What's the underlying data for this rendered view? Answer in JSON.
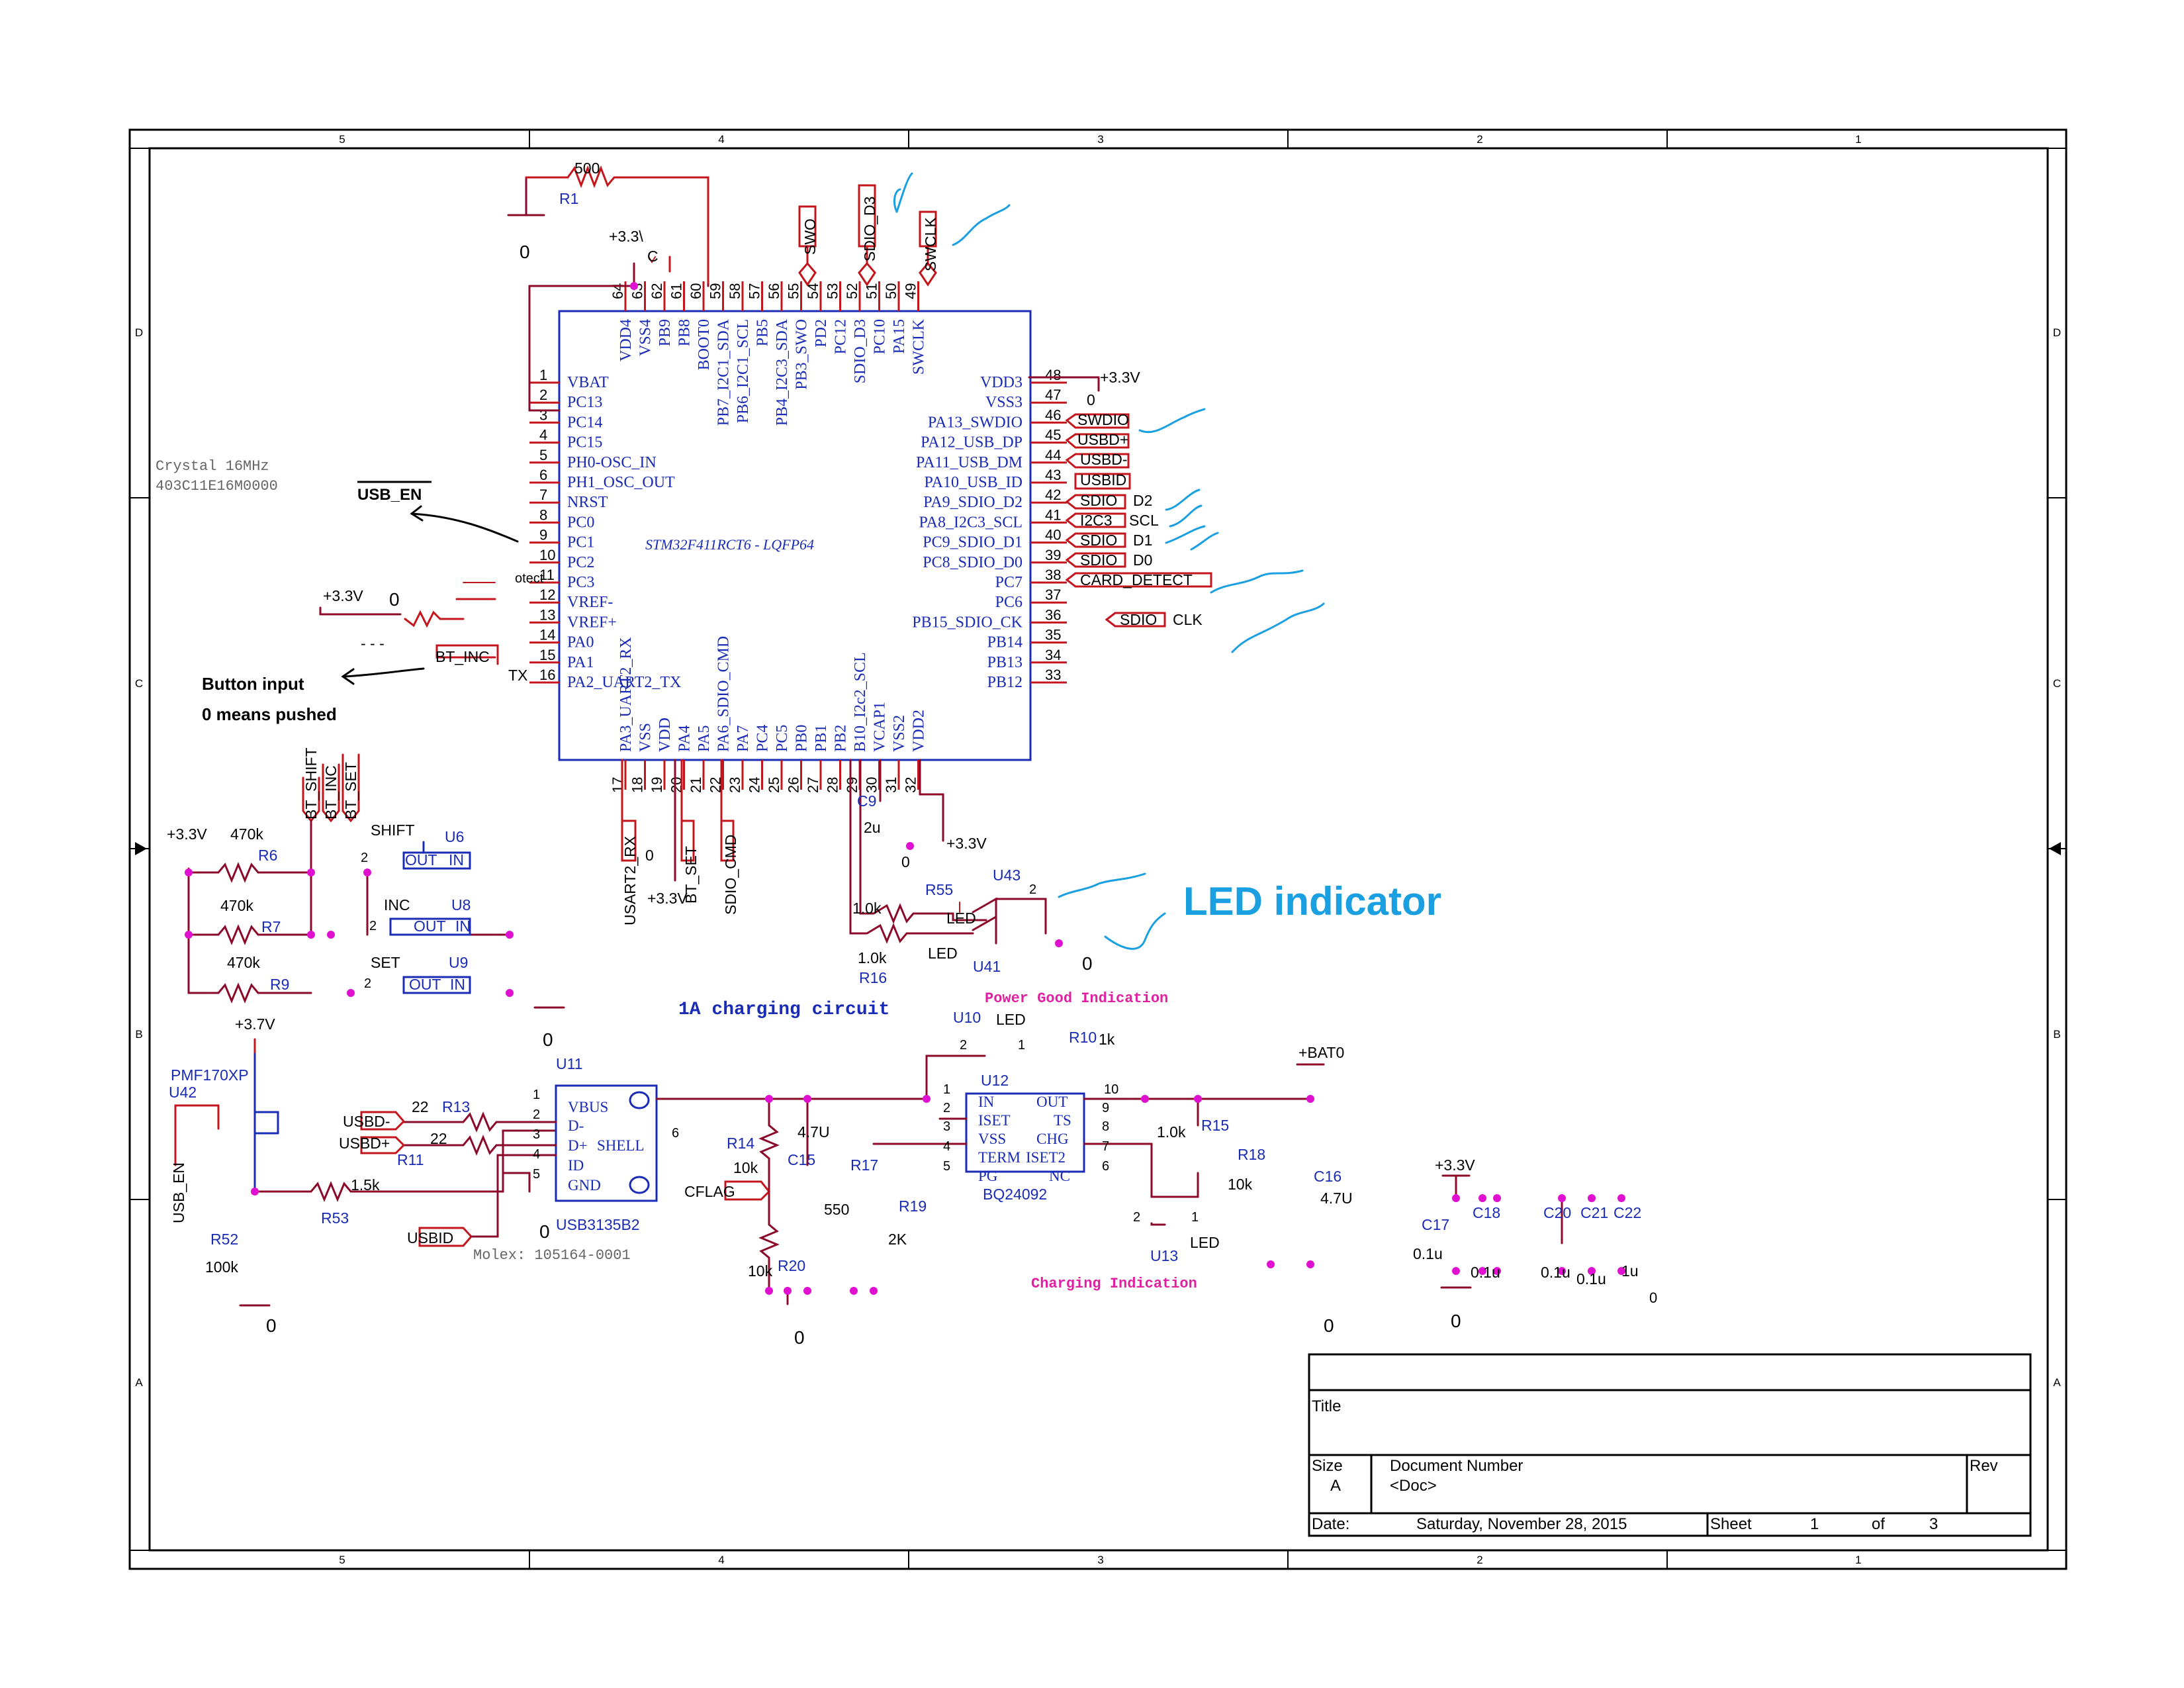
{
  "border": {
    "cols": [
      "5",
      "4",
      "3",
      "2",
      "1"
    ],
    "rows": [
      "D",
      "C",
      "B",
      "A"
    ]
  },
  "mcu": {
    "part": "STM32F411RCT6 - LQFP64",
    "left_pins": [
      {
        "num": "1",
        "name": "VBAT"
      },
      {
        "num": "2",
        "name": "PC13"
      },
      {
        "num": "3",
        "name": "PC14"
      },
      {
        "num": "4",
        "name": "PC15"
      },
      {
        "num": "5",
        "name": "PH0-OSC_IN"
      },
      {
        "num": "6",
        "name": "PH1_OSC_OUT"
      },
      {
        "num": "7",
        "name": "NRST"
      },
      {
        "num": "8",
        "name": "PC0"
      },
      {
        "num": "9",
        "name": "PC1"
      },
      {
        "num": "10",
        "name": "PC2"
      },
      {
        "num": "11",
        "name": "PC3"
      },
      {
        "num": "12",
        "name": "VREF-"
      },
      {
        "num": "13",
        "name": "VREF+"
      },
      {
        "num": "14",
        "name": "PA0"
      },
      {
        "num": "15",
        "name": "PA1"
      },
      {
        "num": "16",
        "name": "PA2_UART2_TX"
      }
    ],
    "right_pins": [
      {
        "num": "48",
        "name": "VDD3"
      },
      {
        "num": "47",
        "name": "VSS3"
      },
      {
        "num": "46",
        "name": "PA13_SWDIO"
      },
      {
        "num": "45",
        "name": "PA12_USB_DP"
      },
      {
        "num": "44",
        "name": "PA11_USB_DM"
      },
      {
        "num": "43",
        "name": "PA10_USB_ID"
      },
      {
        "num": "42",
        "name": "PA9_SDIO_D2"
      },
      {
        "num": "41",
        "name": "PA8_I2C3_SCL"
      },
      {
        "num": "40",
        "name": "PC9_SDIO_D1"
      },
      {
        "num": "39",
        "name": "PC8_SDIO_D0"
      },
      {
        "num": "38",
        "name": "PC7"
      },
      {
        "num": "37",
        "name": "PC6"
      },
      {
        "num": "36",
        "name": "PB15_SDIO_CK"
      },
      {
        "num": "35",
        "name": "PB14"
      },
      {
        "num": "34",
        "name": "PB13"
      },
      {
        "num": "33",
        "name": "PB12"
      }
    ],
    "top_pins": [
      {
        "num": "64",
        "name": "VDD4"
      },
      {
        "num": "63",
        "name": "VSS4"
      },
      {
        "num": "62",
        "name": "PB9"
      },
      {
        "num": "61",
        "name": "PB8"
      },
      {
        "num": "60",
        "name": "BOOT0"
      },
      {
        "num": "59",
        "name": "PB7_I2C1_SDA"
      },
      {
        "num": "58",
        "name": "PB6_I2C1_SCL"
      },
      {
        "num": "57",
        "name": "PB5"
      },
      {
        "num": "56",
        "name": "PB4_I2C3_SDA"
      },
      {
        "num": "55",
        "name": "PB3_SWO"
      },
      {
        "num": "54",
        "name": "PD2"
      },
      {
        "num": "53",
        "name": "PC12"
      },
      {
        "num": "52",
        "name": "SDIO_D3"
      },
      {
        "num": "51",
        "name": "PC10"
      },
      {
        "num": "50",
        "name": "PA15"
      },
      {
        "num": "49",
        "name": "SWCLK"
      }
    ],
    "bottom_pins": [
      {
        "num": "17",
        "name": "PA3_UART2_RX"
      },
      {
        "num": "18",
        "name": "VSS"
      },
      {
        "num": "19",
        "name": "VDD"
      },
      {
        "num": "20",
        "name": "PA4"
      },
      {
        "num": "21",
        "name": "PA5"
      },
      {
        "num": "22",
        "name": "PA6_SDIO_CMD"
      },
      {
        "num": "23",
        "name": "PA7"
      },
      {
        "num": "24",
        "name": "PC4"
      },
      {
        "num": "25",
        "name": "PC5"
      },
      {
        "num": "26",
        "name": "PB0"
      },
      {
        "num": "27",
        "name": "PB1"
      },
      {
        "num": "28",
        "name": "PB2"
      },
      {
        "num": "29",
        "name": "B10_I2c2_SCL"
      },
      {
        "num": "30",
        "name": "VCAP1"
      },
      {
        "num": "31",
        "name": "VSS2"
      },
      {
        "num": "32",
        "name": "VDD2"
      }
    ]
  },
  "labels": {
    "r1": "R1",
    "r1_val": "500",
    "gnd0": "0",
    "p33": "+3.3V",
    "p33_top": "+3.3\\",
    "c_top": "C",
    "swo": "SWO",
    "sdio_d3": "SDIO_D3",
    "swclk": "SWCLK",
    "swdio": "SWDIO",
    "usbdp": "USBD+",
    "usbdm": "USBD-",
    "usbid": "USBID",
    "sdio": "SDIO",
    "d2": "D2",
    "i2c3": "I2C3",
    "scl": "SCL",
    "d1": "D1",
    "d0": "D0",
    "card_detect": "CARD_DETECT",
    "clk": "CLK",
    "crystal1": "Crystal 16MHz",
    "crystal2": "403C11E16M0000",
    "usb_en": "USB_EN",
    "button1": "Button input",
    "button2": "0 means pushed",
    "bt_inc_net": "BT_INC",
    "tx": "TX",
    "zero_vref": "0",
    "stray": "otect",
    "dashes": "- - -",
    "usart2_rx": "USART2_RX",
    "bt_set": "BT_SET",
    "sdio_cmd": "SDIO_CMD",
    "c9": "C9",
    "c9_val": "2u",
    "led_indicator": "LED indicator",
    "r55": "R55",
    "r55_val": "1.0k",
    "r16": "R16",
    "r16_val": "1.0k",
    "u43": "U43",
    "u41": "U41",
    "led": "LED",
    "bt_shift": "BT_SHIFT",
    "bt_inc": "BT_INC",
    "bt_set2": "BT_SET",
    "r6": "R6",
    "r7": "R7",
    "r9": "R9",
    "r470k": "470k",
    "shift": "SHIFT",
    "inc": "INC",
    "set": "SET",
    "out": "OUT",
    "in": "IN",
    "u6": "U6",
    "u8": "U8",
    "u9": "U9",
    "charging_title": "1A charging circuit",
    "pg_title": "Power Good Indication",
    "chg_title": "Charging Indication",
    "p37": "+3.7V",
    "pmf": "PMF170XP",
    "u42": "U42",
    "usb_en_net": "USB_EN",
    "r52": "R52",
    "r52_val": "100k",
    "r53": "R53",
    "r53_val": "1.5k",
    "r13": "R13",
    "r11": "R11",
    "r22": "22",
    "u11": "U11",
    "usb_part": "USB3135B2",
    "molex": "Molex: 105164-0001",
    "vbus": "VBUS",
    "dminus": "D-",
    "dplus": "D+",
    "shell": "SHELL",
    "id": "ID",
    "gnd": "GND",
    "r14": "R14",
    "r14_val": "10k",
    "r20": "R20",
    "r20_val": "10k",
    "c15": "C15",
    "c15_val": "4.7U",
    "r17": "R17",
    "r17_val": "550",
    "r19": "R19",
    "r19_val": "2K",
    "cflag": "CFLAG",
    "u10": "U10",
    "u12": "U12",
    "r10": "R10",
    "r10_val": "1k",
    "bq_part": "BQ24092",
    "bq_in": "IN",
    "bq_iset": "ISET",
    "bq_vss": "VSS",
    "bq_term": "TERM",
    "bq_pg": "PG",
    "bq_out": "OUT",
    "bq_ts": "TS",
    "bq_chg": "CHG",
    "bq_iset2": "ISET2",
    "bq_nc": "NC",
    "r15": "R15",
    "r15_val": "1.0k",
    "r18": "R18",
    "r18_val": "10k",
    "u13": "U13",
    "bat0": "+BAT0",
    "c16": "C16",
    "c16_val": "4.7U",
    "c17": "C17",
    "c18": "C18",
    "c20": "C20",
    "c21": "C21",
    "c22": "C22",
    "v01u": "0.1u",
    "v1u": "1u"
  },
  "title_block": {
    "title_label": "Title",
    "size_label": "Size",
    "size_value": "A",
    "docnum_label": "Document Number",
    "docnum_value": "<Doc>",
    "rev_label": "Rev",
    "date_label": "Date:",
    "date_value": "Saturday, November 28, 2015",
    "sheet_label": "Sheet",
    "sheet_value": "1",
    "of_label": "of",
    "of_value": "3"
  },
  "colors": {
    "wire": "#8b0a2a",
    "blue": "#1a2bb5",
    "pin": "#c4141c",
    "junction": "#e010d0",
    "annot": "#1aa0e0",
    "magenta": "#e020a0",
    "border": "#000000"
  }
}
